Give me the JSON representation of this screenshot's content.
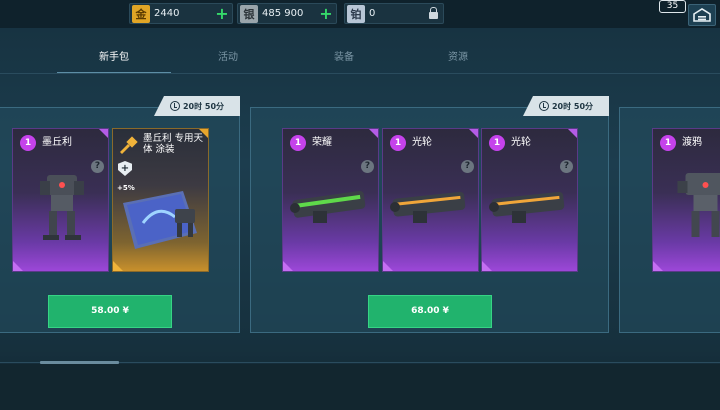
{
  "currencies": {
    "gold": {
      "icon_char": "金",
      "value": "2440"
    },
    "silver": {
      "icon_char": "银",
      "value": "485 900"
    },
    "platinum": {
      "icon_char": "铂",
      "value": "0"
    }
  },
  "level_badge": "35",
  "tabs": [
    {
      "label": "新手包"
    },
    {
      "label": "活动"
    },
    {
      "label": "装备"
    },
    {
      "label": "资源"
    }
  ],
  "offers": [
    {
      "timer": "20时 50分",
      "price": "58.00 ¥",
      "cards": [
        {
          "level": "1",
          "name": "墨丘利",
          "type": "robot"
        },
        {
          "level": "",
          "name": "墨丘利 专用天体 涂装",
          "type": "skin",
          "bonus": "+5%"
        }
      ]
    },
    {
      "timer": "20时 50分",
      "price": "68.00 ¥",
      "cards": [
        {
          "level": "1",
          "name": "荣耀",
          "type": "weapon"
        },
        {
          "level": "1",
          "name": "光轮",
          "type": "weapon"
        },
        {
          "level": "1",
          "name": "光轮",
          "type": "weapon"
        }
      ]
    },
    {
      "cards": [
        {
          "level": "1",
          "name": "渡鸦",
          "type": "robot"
        }
      ]
    }
  ],
  "colors": {
    "accent_green": "#21b36d",
    "epic_purple": "#9c47d8",
    "skin_gold": "#c8902c",
    "add_green": "#35d86a"
  }
}
